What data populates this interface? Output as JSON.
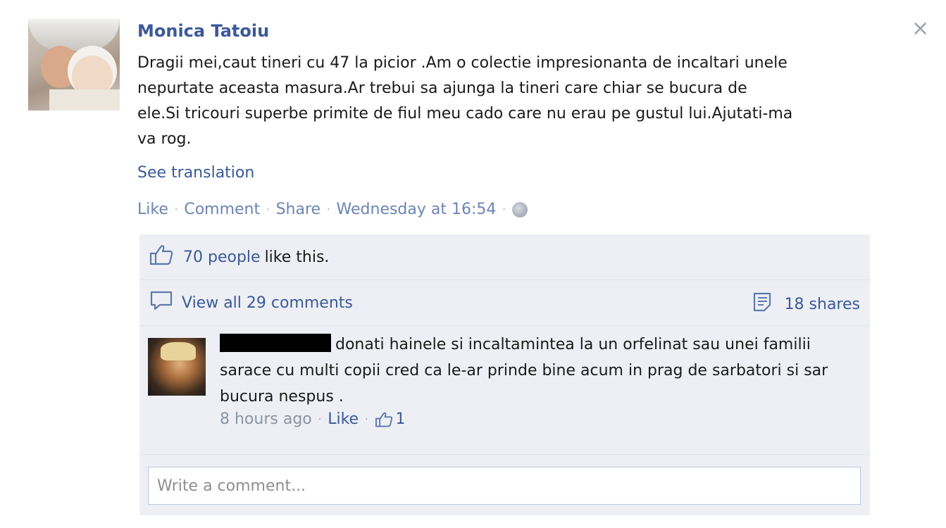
{
  "post": {
    "author": "Monica Tatoiu",
    "text": "Dragii mei,caut tineri cu 47 la picior .Am o colectie impresionanta de incaltari unele\nnepurtate aceasta masura.Ar trebui sa ajunga la tineri care chiar se bucura de\nele.Si tricouri superbe primite de fiul meu cado care nu erau pe gustul lui.Ajutati-ma\nva rog.",
    "see_translation": "See translation",
    "actions": {
      "like": "Like",
      "comment": "Comment",
      "share": "Share",
      "timestamp": "Wednesday at 16:54"
    },
    "close_glyph": "×"
  },
  "likes": {
    "people_link": "70 people",
    "suffix": "like this."
  },
  "comments_row": {
    "view_all": "View all 29 comments",
    "shares": "18 shares"
  },
  "comment": {
    "text": "donati hainele si incaltamintea la un orfelinat sau unei familii sarace cu multi copii cred ca le-ar prinde bine acum in prag de sarbatori si sar bucura nespus .",
    "time": "8 hours ago",
    "like": "Like",
    "like_count": "1"
  },
  "write_comment": {
    "placeholder": "Write a comment..."
  },
  "icons": {
    "thumb": "thumbs-up-icon",
    "comment": "speech-bubble-icon",
    "share": "share-icon",
    "globe": "globe-icon",
    "close": "close-icon"
  },
  "colors": {
    "link": "#3b5998",
    "meta": "#8a93a3",
    "panel": "#edeff4"
  }
}
